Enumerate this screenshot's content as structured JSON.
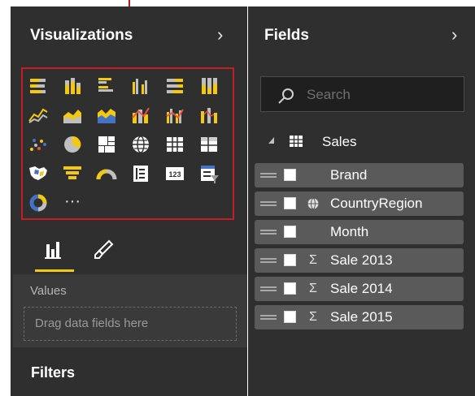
{
  "colors": {
    "panel_bg": "#2f2f2f",
    "highlight": "#c41e24",
    "accent": "#f2c811"
  },
  "visualizations": {
    "title": "Visualizations",
    "chevron_icon": "chevron-right-icon",
    "icons": [
      "stacked-bar-chart-icon",
      "stacked-column-chart-icon",
      "clustered-bar-chart-icon",
      "clustered-column-chart-icon",
      "100-stacked-bar-chart-icon",
      "100-stacked-column-chart-icon",
      "line-chart-icon",
      "area-chart-icon",
      "stacked-area-chart-icon",
      "line-and-stacked-column-chart-icon",
      "line-and-clustered-column-chart-icon",
      "ribbon-chart-icon",
      "scatter-chart-icon",
      "pie-chart-icon",
      "treemap-icon",
      "map-icon",
      "table-icon",
      "matrix-icon",
      "filled-map-icon",
      "funnel-icon",
      "gauge-icon",
      "multi-row-card-icon",
      "card-icon",
      "slicer-icon",
      "donut-chart-icon",
      "more-visuals-icon"
    ],
    "card_text": "123",
    "more_text": "···",
    "tabs": [
      {
        "name": "fields-tab",
        "icon": "bar-chart-icon"
      },
      {
        "name": "format-tab",
        "icon": "paintbrush-icon"
      }
    ],
    "values_label": "Values",
    "dropzone_text": "Drag data fields here",
    "filters_title": "Filters"
  },
  "fields": {
    "title": "Fields",
    "chevron_icon": "chevron-right-icon",
    "search_placeholder": "Search",
    "table_name": "Sales",
    "items": [
      {
        "label": "Brand",
        "type_icon": ""
      },
      {
        "label": "CountryRegion",
        "type_icon": "globe-icon"
      },
      {
        "label": "Month",
        "type_icon": ""
      },
      {
        "label": "Sale 2013",
        "type_icon": "sigma-icon"
      },
      {
        "label": "Sale 2014",
        "type_icon": "sigma-icon"
      },
      {
        "label": "Sale 2015",
        "type_icon": "sigma-icon"
      }
    ]
  }
}
